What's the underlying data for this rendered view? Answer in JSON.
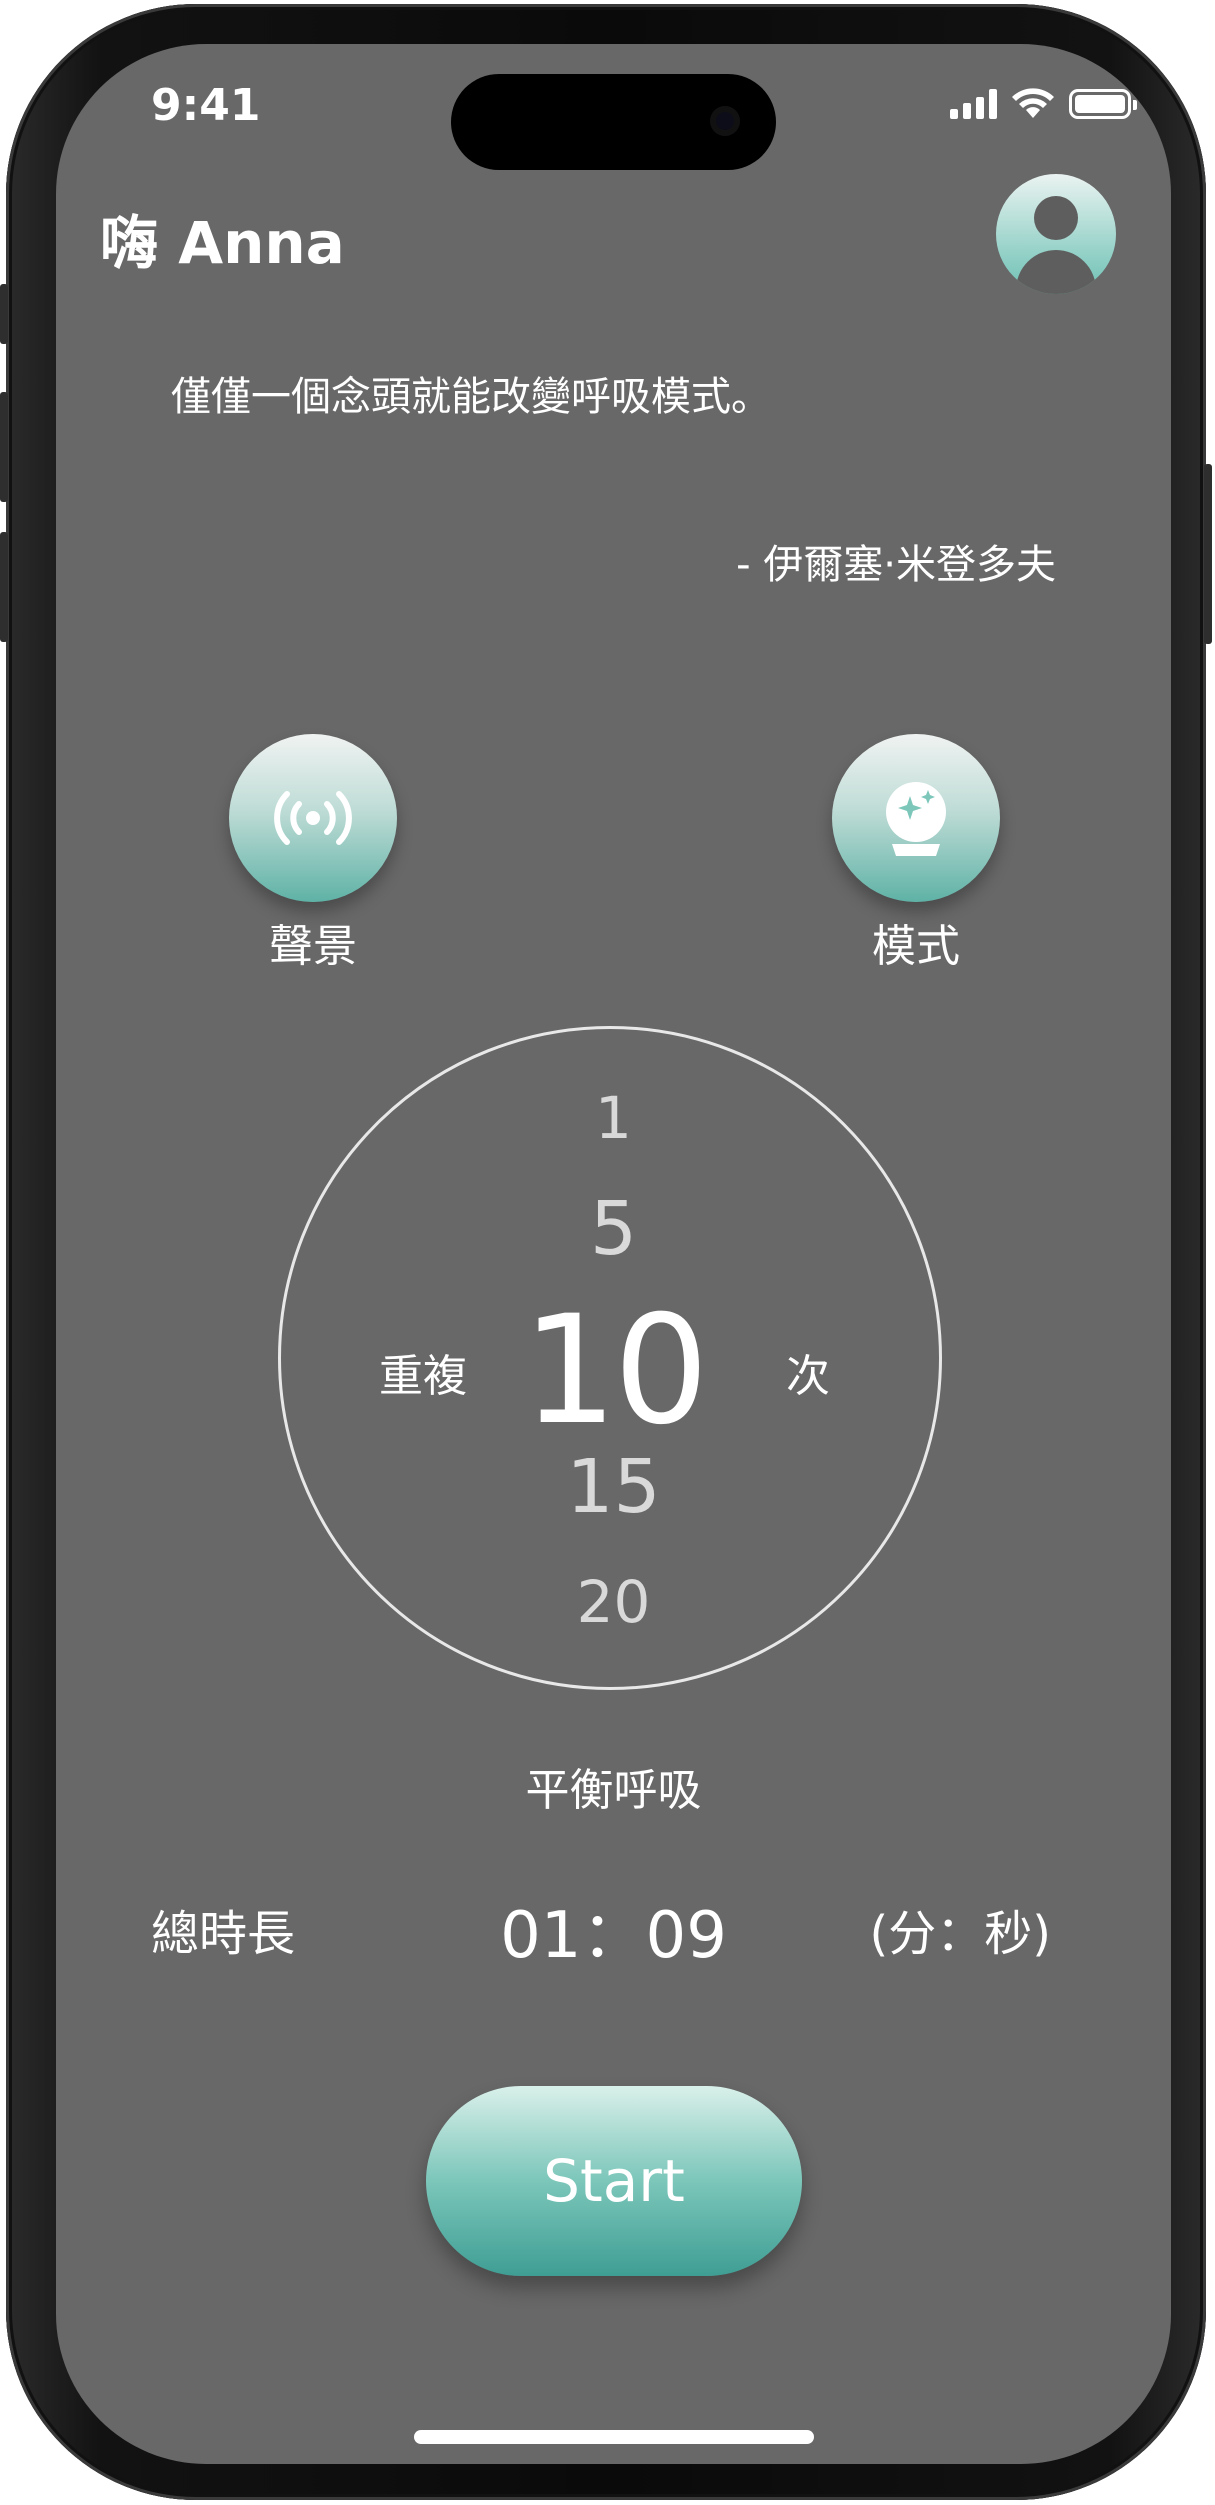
{
  "status_bar": {
    "time": "9:41"
  },
  "header": {
    "greeting": "嗨 Anna",
    "avatar_icon": "user-avatar-icon"
  },
  "quote": {
    "text": "僅僅一個念頭就能改變呼吸模式。",
    "author": "- 伊爾塞·米登多夫"
  },
  "actions": {
    "soundscape_label": "聲景",
    "soundscape_icon": "broadcast-icon",
    "mode_label": "模式",
    "mode_icon": "crystal-ball-icon"
  },
  "picker": {
    "prefix_label": "重複",
    "suffix_label": "次",
    "options": [
      "1",
      "5",
      "10",
      "15",
      "20"
    ],
    "selected": "10"
  },
  "mode_name": "平衡呼吸",
  "duration": {
    "label": "總時長",
    "value": "01：09",
    "unit": "(分：秒)"
  },
  "start_button": {
    "label": "Start"
  },
  "colors": {
    "background": "#686868",
    "accent_teal": "#5fb2a6",
    "text": "#ffffff"
  }
}
